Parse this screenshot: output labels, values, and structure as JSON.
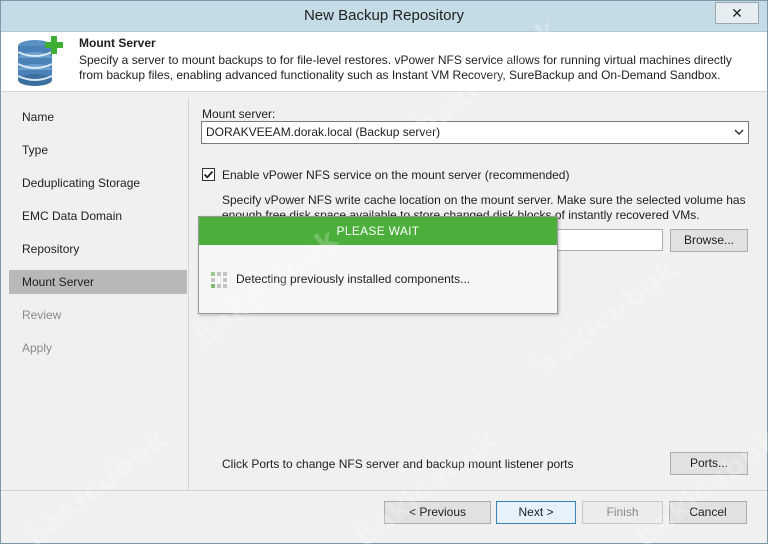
{
  "window": {
    "title": "New Backup Repository",
    "close_glyph": "✕"
  },
  "header": {
    "title": "Mount Server",
    "description": "Specify a server to mount backups to for file-level restores. vPower NFS service allows for running virtual machines directly from backup files, enabling advanced functionality such as Instant VM Recovery, SureBackup and On-Demand Sandbox.",
    "icon": "database-add-icon"
  },
  "nav": {
    "items": [
      {
        "label": "Name",
        "state": "normal"
      },
      {
        "label": "Type",
        "state": "normal"
      },
      {
        "label": "Deduplicating Storage",
        "state": "normal"
      },
      {
        "label": "EMC Data Domain",
        "state": "normal"
      },
      {
        "label": "Repository",
        "state": "normal"
      },
      {
        "label": "Mount Server",
        "state": "active"
      },
      {
        "label": "Review",
        "state": "disabled"
      },
      {
        "label": "Apply",
        "state": "disabled"
      }
    ]
  },
  "main": {
    "mount_server_label": "Mount server:",
    "mount_server_value": "DORAKVEEAM.dorak.local (Backup server)",
    "nfs_checkbox_label": "Enable vPower NFS service on the mount server (recommended)",
    "nfs_checkbox_checked": true,
    "cache_location_text_1": "Specify vPower NFS write cache location on the mount server. Make sure the selected volume has",
    "cache_location_text_2": "enough free disk space available to store changed disk blocks of instantly recovered VMs.",
    "browse_label": "Browse...",
    "ports_hint": "Click Ports to change NFS server and backup mount listener ports",
    "ports_label": "Ports..."
  },
  "footer": {
    "previous_label": "< Previous",
    "next_label": "Next >",
    "finish_label": "Finish",
    "cancel_label": "Cancel"
  },
  "modal": {
    "title": "PLEASE WAIT",
    "message": "Detecting previously installed components..."
  },
  "colors": {
    "accent_green": "#4cae3b",
    "titlebar": "#c5dbe6",
    "active_nav": "#b8b8b8"
  },
  "watermark": "bakicubuk"
}
